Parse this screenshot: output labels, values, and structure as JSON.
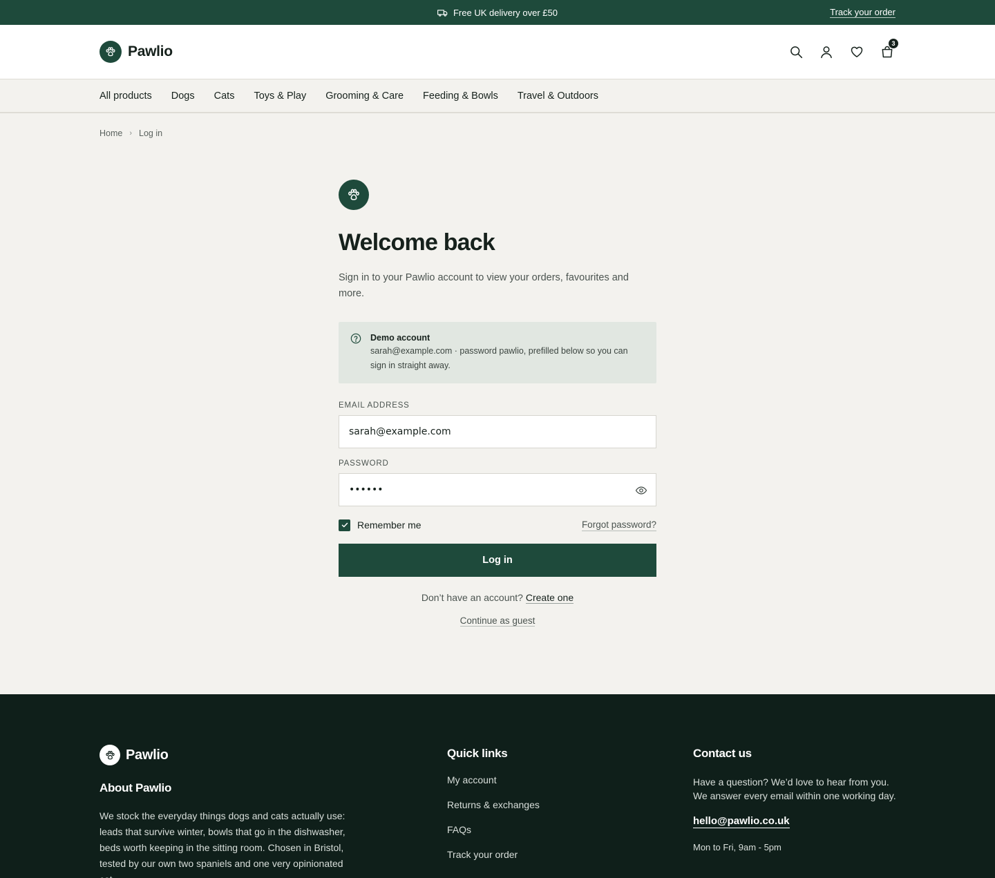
{
  "announcement": {
    "message": "Free UK delivery over £50",
    "track_link": "Track your order"
  },
  "header": {
    "brand": "Pawlio",
    "cart_count": "3"
  },
  "nav": [
    "All products",
    "Dogs",
    "Cats",
    "Toys & Play",
    "Grooming & Care",
    "Feeding & Bowls",
    "Travel & Outdoors"
  ],
  "breadcrumb": {
    "home": "Home",
    "current": "Log in"
  },
  "login": {
    "title": "Welcome back",
    "subtitle": "Sign in to your Pawlio account to view your orders, favourites and more.",
    "demo_title": "Demo account",
    "demo_body": "sarah@example.com · password pawlio, prefilled below so you can sign in straight away.",
    "email_label": "Email address",
    "email_value": "sarah@example.com",
    "password_label": "Password",
    "password_value": "pawlio",
    "remember_label": "Remember me",
    "remember_checked": true,
    "forgot_label": "Forgot password?",
    "submit_label": "Log in",
    "no_account_text": "Don’t have an account?",
    "create_link": "Create one",
    "guest_link": "Continue as guest"
  },
  "footer": {
    "brand": "Pawlio",
    "about_title": "About Pawlio",
    "about_text": "We stock the everyday things dogs and cats actually use: leads that survive winter, bowls that go in the dishwasher, beds worth keeping in the sitting room. Chosen in Bristol, tested by our own two spaniels and one very opinionated cat.",
    "quick_title": "Quick links",
    "quick_links": [
      "My account",
      "Returns & exchanges",
      "FAQs",
      "Track your order"
    ],
    "contact_title": "Contact us",
    "contact_text": "Have a question? We’d love to hear from you. We answer every email within one working day.",
    "contact_email": "hello@pawlio.co.uk",
    "contact_hours": "Mon to Fri, 9am - 5pm"
  },
  "colors": {
    "brand_green": "#1e4a3b",
    "footer_bg": "#0f1f1a",
    "page_bg": "#f3f2ee",
    "demo_bg": "#e1e7e1"
  },
  "icons": [
    "truck-icon",
    "paw-icon",
    "search-icon",
    "user-icon",
    "heart-icon",
    "bag-icon",
    "chevron-right-icon",
    "help-circle-icon",
    "eye-icon",
    "check-icon"
  ]
}
